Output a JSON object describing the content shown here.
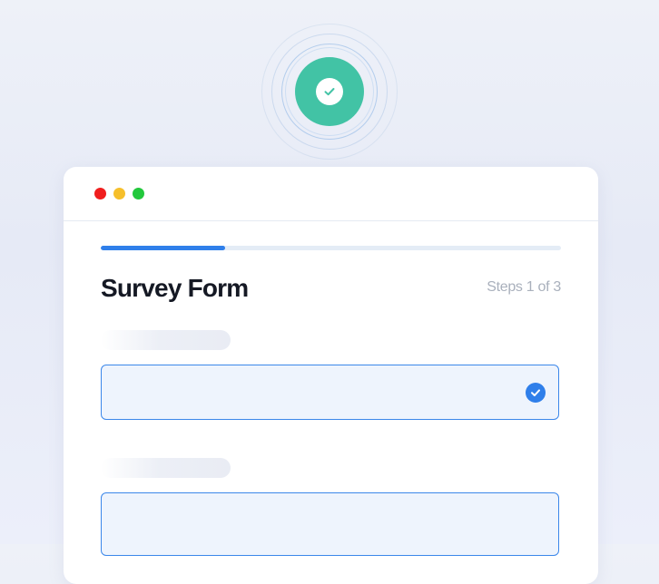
{
  "form": {
    "title": "Survey Form",
    "steps_text": "Steps 1 of 3",
    "progress_fraction": 0.27
  },
  "colors": {
    "badge": "#42c3a5",
    "accent": "#2f7fea",
    "window_controls": [
      "#f01e1e",
      "#f6bf2b",
      "#22c83c"
    ]
  },
  "icons": {
    "badge": "check-icon",
    "field_status": "check-circle-icon"
  }
}
